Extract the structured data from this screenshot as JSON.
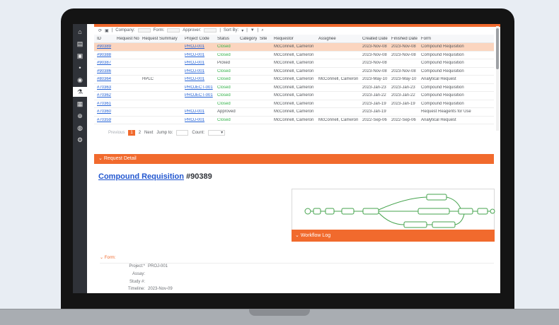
{
  "sidebar": {
    "items": [
      {
        "icon": "home-icon",
        "glyph": "⌂"
      },
      {
        "icon": "document-icon",
        "glyph": "▤"
      },
      {
        "icon": "calendar-icon",
        "glyph": "▣"
      },
      {
        "icon": "bell-icon",
        "glyph": "•"
      },
      {
        "icon": "user-icon",
        "glyph": "◉"
      },
      {
        "icon": "flask-icon",
        "glyph": "⚗"
      },
      {
        "icon": "book-icon",
        "glyph": "▦"
      },
      {
        "icon": "plus-circle-icon",
        "glyph": "⊕"
      },
      {
        "icon": "chat-icon",
        "glyph": "◍"
      },
      {
        "icon": "settings-icon",
        "glyph": "⚙"
      }
    ]
  },
  "toolbar": {
    "company_label": "Company:",
    "form_label": "Form:",
    "approver_label": "Approver:",
    "sort_label": "Sort By:"
  },
  "table": {
    "headers": [
      "ID",
      "Request No",
      "Request Summary",
      "Project Code",
      "Status",
      "Category",
      "Site",
      "Requestor",
      "Assignee",
      "Created Date",
      "Finished Date",
      "Form"
    ],
    "rows": [
      {
        "id": "#90389",
        "request_no": "",
        "summary": "",
        "project": "PROJ-001",
        "status": "Closed",
        "category": "",
        "site": "",
        "requestor": "McConnell, Cameron",
        "assignee": "",
        "created": "2023-Nov-08",
        "finished": "2023-Nov-08",
        "form": "Compound Requisition"
      },
      {
        "id": "#90388",
        "request_no": "",
        "summary": "",
        "project": "PROJ-001",
        "status": "Closed",
        "category": "",
        "site": "",
        "requestor": "McConnell, Cameron",
        "assignee": "",
        "created": "2023-Nov-08",
        "finished": "2023-Nov-08",
        "form": "Compound Requisition"
      },
      {
        "id": "#90387",
        "request_no": "",
        "summary": "",
        "project": "PROJ-001",
        "status": "Picked",
        "category": "",
        "site": "",
        "requestor": "McConnell, Cameron",
        "assignee": "",
        "created": "2023-Nov-08",
        "finished": "",
        "form": "Compound Requisition"
      },
      {
        "id": "#90386",
        "request_no": "",
        "summary": "",
        "project": "PROJ-001",
        "status": "Closed",
        "category": "",
        "site": "",
        "requestor": "McConnell, Cameron",
        "assignee": "",
        "created": "2023-Nov-08",
        "finished": "2023-Nov-08",
        "form": "Compound Requisition"
      },
      {
        "id": "#80364",
        "request_no": "",
        "summary": "HPLC",
        "project": "PROJ-001",
        "status": "Closed",
        "category": "",
        "site": "",
        "requestor": "McConnell, Cameron",
        "assignee": "McConnell, Cameron",
        "created": "2023-May-10",
        "finished": "2023-May-10",
        "form": "Analytical Request"
      },
      {
        "id": "#70363",
        "request_no": "",
        "summary": "",
        "project": "PROJECT-001",
        "status": "Closed",
        "category": "",
        "site": "",
        "requestor": "McConnell, Cameron",
        "assignee": "",
        "created": "2023-Jan-23",
        "finished": "2023-Jan-23",
        "form": "Compound Requisition"
      },
      {
        "id": "#70362",
        "request_no": "",
        "summary": "",
        "project": "PROJECT-001",
        "status": "Closed",
        "category": "",
        "site": "",
        "requestor": "McConnell, Cameron",
        "assignee": "",
        "created": "2023-Jan-22",
        "finished": "2023-Jan-22",
        "form": "Compound Requisition"
      },
      {
        "id": "#70361",
        "request_no": "",
        "summary": "",
        "project": "",
        "status": "Closed",
        "category": "",
        "site": "",
        "requestor": "McConnell, Cameron",
        "assignee": "",
        "created": "2023-Jan-19",
        "finished": "2023-Jan-19",
        "form": "Compound Requisition"
      },
      {
        "id": "#70360",
        "request_no": "",
        "summary": "",
        "project": "PROJ-001",
        "status": "Approved",
        "category": "",
        "site": "",
        "requestor": "McConnell, Cameron",
        "assignee": "",
        "created": "2023-Jan-19",
        "finished": "",
        "form": "Request Reagents for Use"
      },
      {
        "id": "#70359",
        "request_no": "",
        "summary": "",
        "project": "PROJ-001",
        "status": "Closed",
        "category": "",
        "site": "",
        "requestor": "McConnell, Cameron",
        "assignee": "McConnell, Cameron",
        "created": "2022-Sep-06",
        "finished": "2022-Sep-06",
        "form": "Analytical Request"
      }
    ]
  },
  "pager": {
    "previous": "Previous",
    "pages": [
      "1",
      "2"
    ],
    "next": "Next",
    "jump_label": "Jump to:",
    "count_label": "Count:"
  },
  "detail": {
    "section_label": "Request Detail",
    "title_link": "Compound Requisition",
    "title_id": "#90389",
    "workflow_label": "Workflow Log"
  },
  "form": {
    "section_label": "Form:",
    "fields": [
      {
        "label": "Project:*",
        "value": "PROJ-001"
      },
      {
        "label": "Assay:",
        "value": ""
      },
      {
        "label": "Study #:",
        "value": ""
      },
      {
        "label": "Timeline:",
        "value": "2023-Nov-09"
      }
    ]
  },
  "colors": {
    "accent": "#f16a2d",
    "selected_row": "#fbd5bf",
    "link": "#2462d6",
    "closed_status": "#34b24a"
  }
}
